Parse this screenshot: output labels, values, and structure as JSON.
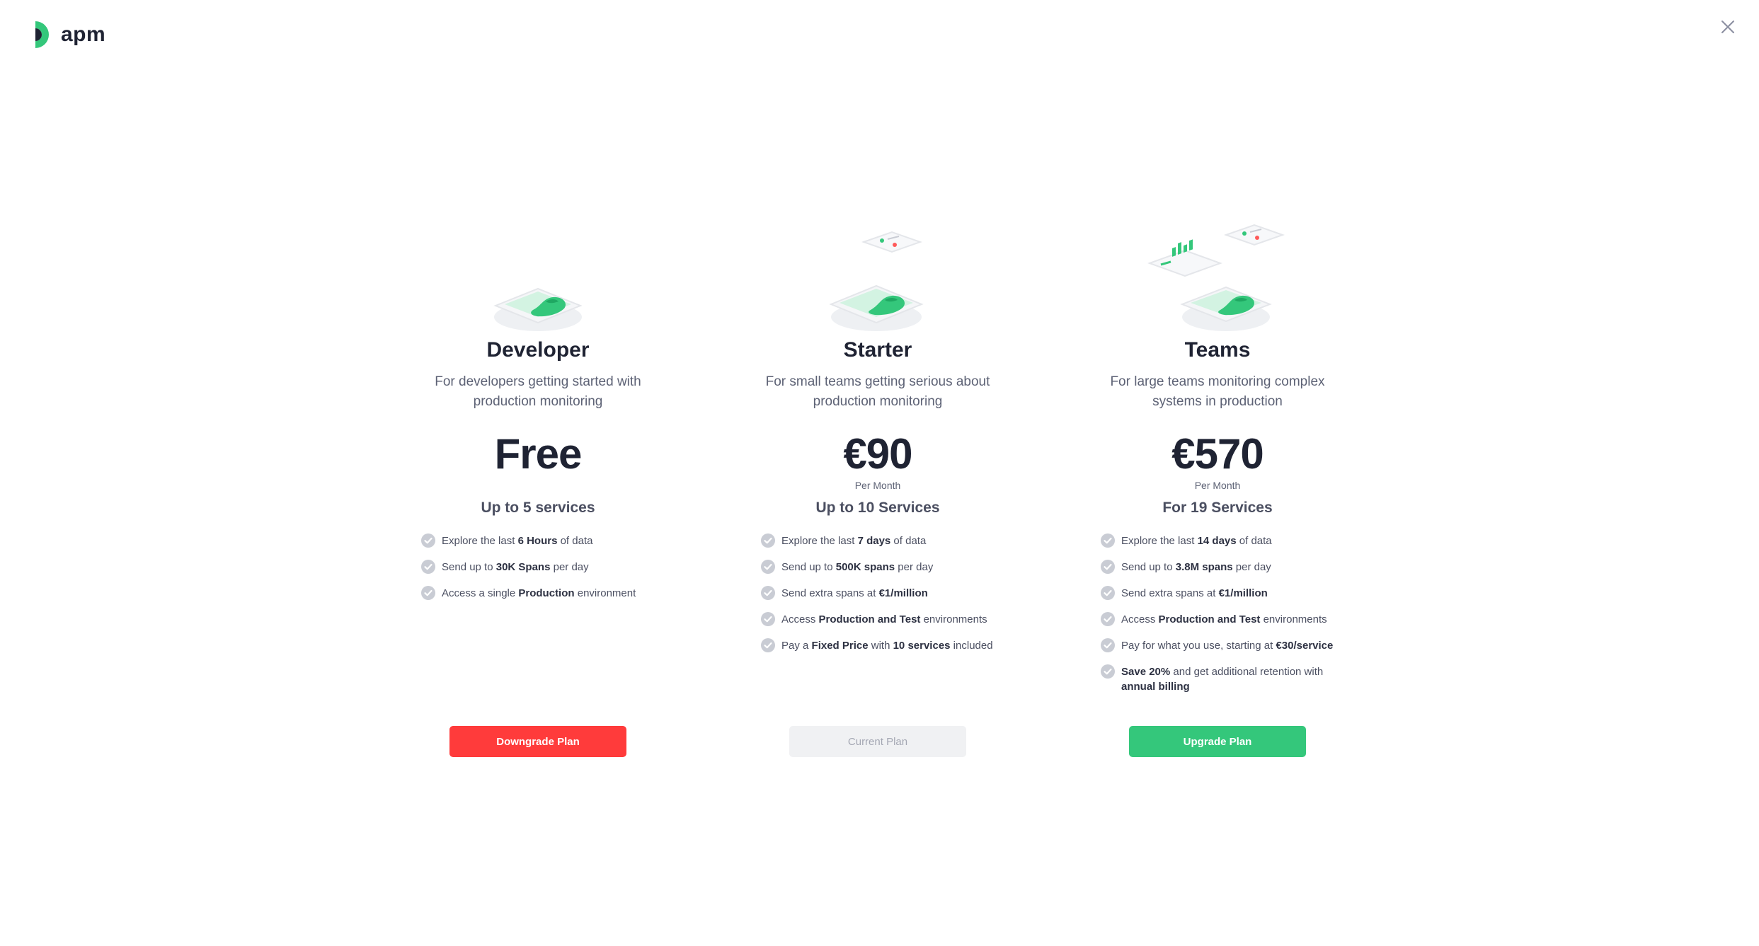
{
  "app": {
    "name": "apm"
  },
  "colors": {
    "brand_green": "#34c77b",
    "danger_red": "#ff3b3b",
    "disabled_grey": "#f0f1f3"
  },
  "icons": {
    "close": "close-icon",
    "check": "check-circle-icon"
  },
  "plans": [
    {
      "name": "Developer",
      "description": "For developers getting started with production monitoring",
      "price": "Free",
      "per_month": "",
      "services": "Up to 5 services",
      "features": [
        [
          "Explore the last ",
          "6 Hours",
          " of data"
        ],
        [
          "Send up to ",
          "30K Spans",
          " per day"
        ],
        [
          "Access a single ",
          "Production",
          " environment"
        ]
      ],
      "button": "Downgrade Plan"
    },
    {
      "name": "Starter",
      "description": "For small teams getting serious about production monitoring",
      "price": "€90",
      "per_month": "Per Month",
      "services": "Up to 10 Services",
      "features": [
        [
          "Explore the last ",
          "7 days",
          " of data"
        ],
        [
          "Send up to ",
          "500K spans",
          " per day"
        ],
        [
          "Send extra spans at ",
          "€1/million",
          ""
        ],
        [
          "Access ",
          "Production and Test",
          " environments"
        ],
        [
          "Pay a ",
          "Fixed Price",
          " with ",
          "10 services",
          " included"
        ]
      ],
      "button": "Current Plan"
    },
    {
      "name": "Teams",
      "description": "For large teams monitoring complex systems in production",
      "price": "€570",
      "per_month": "Per Month",
      "services": "For 19 Services",
      "features": [
        [
          "Explore the last ",
          "14 days",
          " of data"
        ],
        [
          "Send up to ",
          "3.8M spans",
          " per day"
        ],
        [
          "Send extra spans at ",
          "€1/million",
          ""
        ],
        [
          "Access ",
          "Production and Test",
          " environments"
        ],
        [
          "Pay for what you use, starting at ",
          "€30/service",
          ""
        ],
        [
          "",
          "Save 20%",
          " and get additional retention with ",
          "annual billing",
          ""
        ]
      ],
      "button": "Upgrade Plan"
    }
  ]
}
